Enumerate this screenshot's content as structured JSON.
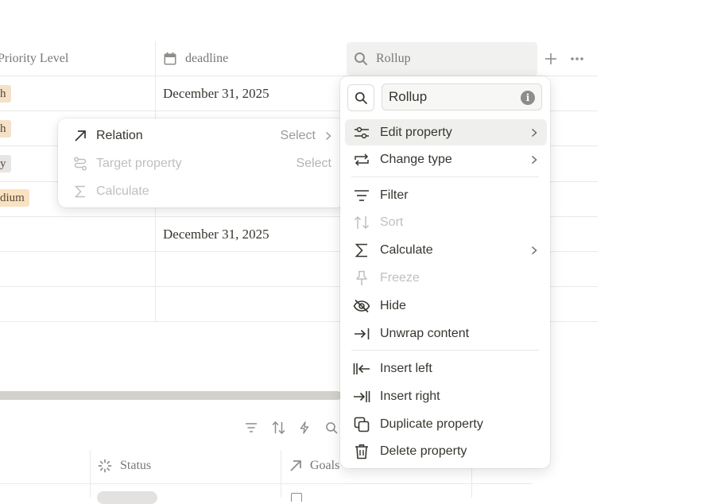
{
  "table": {
    "columns": [
      {
        "label": "Priority Level"
      },
      {
        "label": "deadline"
      },
      {
        "label": "Rollup"
      }
    ],
    "priority_tags": [
      {
        "text": "h",
        "bg": "#f5e0c8"
      },
      {
        "text": "h",
        "bg": "#f5e0c8"
      },
      {
        "text": "y",
        "bg": "#e6e6e4"
      },
      {
        "text": "dium",
        "bg": "#f9e2c2"
      }
    ],
    "deadlines": [
      "December 31, 2025",
      "December 31, 2025"
    ]
  },
  "bottom_table": {
    "columns": [
      {
        "label": "Status"
      },
      {
        "label": "Goals"
      }
    ]
  },
  "relation_popup": {
    "rows": [
      {
        "label": "Relation",
        "value": "Select"
      },
      {
        "label": "Target property",
        "value": "Select"
      },
      {
        "label": "Calculate",
        "value": ""
      }
    ]
  },
  "property_menu": {
    "name_value": "Rollup",
    "items": [
      {
        "label": "Edit property"
      },
      {
        "label": "Change type"
      },
      {
        "label": "Filter"
      },
      {
        "label": "Sort"
      },
      {
        "label": "Calculate"
      },
      {
        "label": "Freeze"
      },
      {
        "label": "Hide"
      },
      {
        "label": "Unwrap content"
      },
      {
        "label": "Insert left"
      },
      {
        "label": "Insert right"
      },
      {
        "label": "Duplicate property"
      },
      {
        "label": "Delete property"
      }
    ]
  }
}
